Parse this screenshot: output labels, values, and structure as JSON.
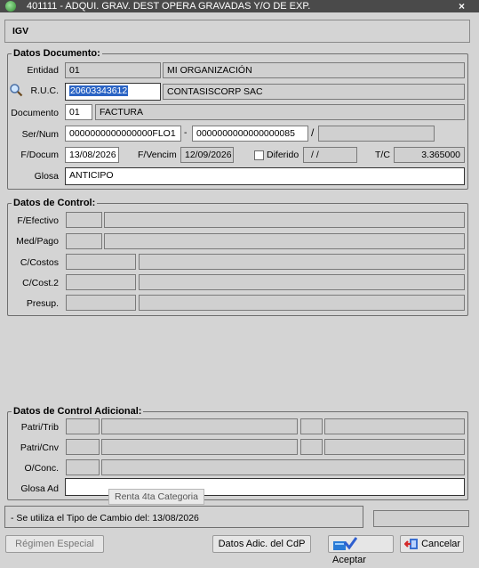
{
  "window": {
    "title": "401111 - ADQUI. GRAV. DEST OPERA GRAVADAS Y/O DE EXP.",
    "close": "×"
  },
  "tax_label": "IGV",
  "doc": {
    "legend": "Datos Documento:",
    "entidad_label": "Entidad",
    "entidad_code": "01",
    "entidad_name": "MI ORGANIZACIÓN",
    "ruc_label": "R.U.C.",
    "ruc_value": "20603343612",
    "ruc_name": "CONTASISCORP SAC",
    "documento_label": "Documento",
    "documento_code": "01",
    "documento_name": "FACTURA",
    "sernum_label": "Ser/Num",
    "serie": "0000000000000000FLO1",
    "dash": "-",
    "numero": "0000000000000000085",
    "slash": "/",
    "fdocum_label": "F/Docum",
    "fdocum": "13/08/2026",
    "fvencim_label": "F/Vencim",
    "fvencim": "12/09/2026",
    "diferido_label": "Diferido",
    "diferido_value": "/ /",
    "tc_label": "T/C",
    "tc_value": "3.365000",
    "glosa_label": "Glosa",
    "glosa": "ANTICIPO"
  },
  "control": {
    "legend": "Datos de Control:",
    "fefectivo_label": "F/Efectivo",
    "medpago_label": "Med/Pago",
    "ccostos_label": "C/Costos",
    "ccost2_label": "C/Cost.2",
    "presup_label": "Presup."
  },
  "adicional": {
    "legend": "Datos de Control Adicional:",
    "patritrib_label": "Patri/Trib",
    "patricnv_label": "Patri/Cnv",
    "oconc_label": "O/Conc.",
    "glosaad_label": "Glosa Ad"
  },
  "tooltip": "Renta 4ta Categoria",
  "status_message": "- Se utiliza el Tipo de Cambio del: 13/08/2026",
  "buttons": {
    "regimen": "Régimen Especial",
    "datos_adic": "Datos Adic. del CdP",
    "aceptar": "Aceptar",
    "cancelar": "Cancelar"
  }
}
